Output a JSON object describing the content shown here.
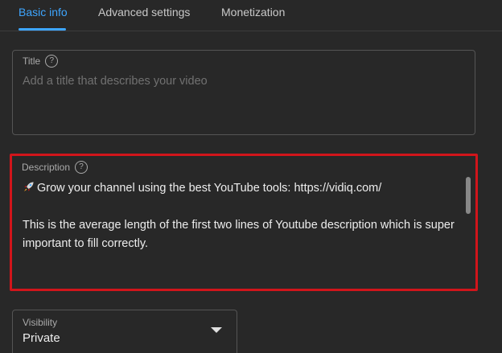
{
  "tabs": [
    {
      "label": "Basic info",
      "active": true
    },
    {
      "label": "Advanced settings",
      "active": false
    },
    {
      "label": "Monetization",
      "active": false
    }
  ],
  "title_field": {
    "label": "Title",
    "placeholder": "Add a title that describes your video",
    "value": ""
  },
  "description_field": {
    "label": "Description",
    "line1": "Grow your channel using the best YouTube tools: https://vidiq.com/",
    "line1_icon": "rocket-icon",
    "line2": "This is the average length of the first two lines of Youtube description which is super important to fill correctly.",
    "highlight_color": "#d1151b"
  },
  "visibility_field": {
    "label": "Visibility",
    "value": "Private"
  },
  "colors": {
    "accent": "#3ea6ff",
    "background": "#282828"
  }
}
